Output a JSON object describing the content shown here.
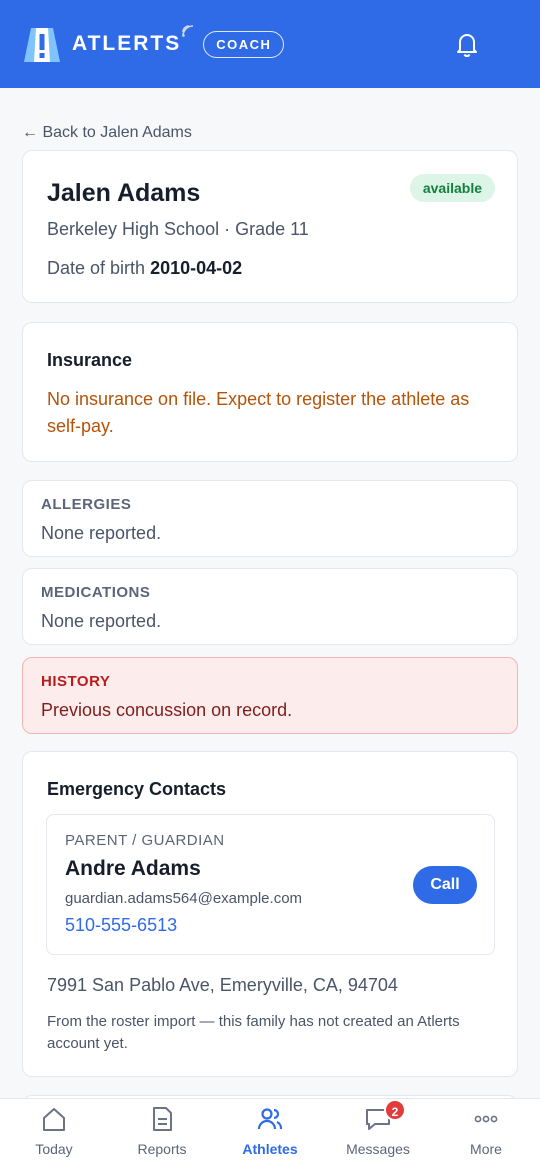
{
  "app": {
    "brand": "ATLERTS",
    "role": "COACH",
    "colors": {
      "primary": "#2f6be6",
      "warning": "#b45309",
      "danger": "#b91c1c",
      "success": "#15803d"
    }
  },
  "back_link": "← Back to Jalen Adams",
  "athlete": {
    "name": "Jalen Adams",
    "status": "available",
    "school_grade": "Berkeley High School · Grade 11",
    "dob_label": "Date of birth",
    "dob": "2010-04-02"
  },
  "insurance": {
    "title": "Insurance",
    "text": "No insurance on file. Expect to register the athlete as self-pay."
  },
  "allergies": {
    "label": "ALLERGIES",
    "text": "None reported."
  },
  "medications": {
    "label": "MEDICATIONS",
    "text": "None reported."
  },
  "history": {
    "label": "HISTORY",
    "text": "Previous concussion on record."
  },
  "emergency": {
    "title": "Emergency Contacts",
    "contact": {
      "role": "PARENT / GUARDIAN",
      "name": "Andre Adams",
      "email": "guardian.adams564@example.com",
      "phone": "510-555-6513",
      "call_label": "Call"
    },
    "address": "7991 San Pablo Ave, Emeryville, CA, 94704",
    "note": "From the roster import — this family has not created an Atlerts account yet."
  },
  "tabs": [
    {
      "label": "Today",
      "icon": "home-icon"
    },
    {
      "label": "Reports",
      "icon": "document-icon"
    },
    {
      "label": "Athletes",
      "icon": "users-icon",
      "active": true
    },
    {
      "label": "Messages",
      "icon": "chat-icon",
      "badge": "2"
    },
    {
      "label": "More",
      "icon": "more-icon"
    }
  ]
}
